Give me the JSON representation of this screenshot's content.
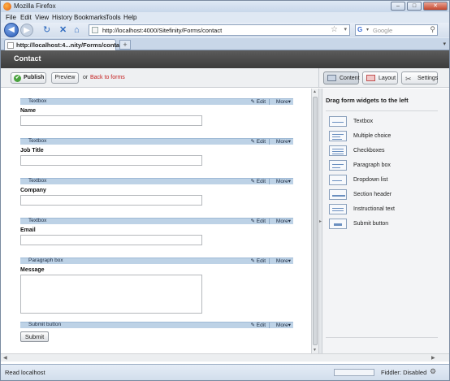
{
  "browser": {
    "window_title": "Mozilla Firefox",
    "menu": [
      "File",
      "Edit",
      "View",
      "History",
      "Bookmarks",
      "Tools",
      "Help"
    ],
    "url": "http://localhost:4000/Sitefinity/Forms/contact",
    "search_placeholder": "Google",
    "tab_title": "http://localhost:4...nity/Forms/contact",
    "new_tab_symbol": "+",
    "status_text": "Read localhost",
    "fiddler_status": "Fiddler: Disabled",
    "icons": [
      "back-icon",
      "forward-icon",
      "reload-icon",
      "stop-icon",
      "home-icon",
      "star-icon",
      "search-icon",
      "gear-icon"
    ]
  },
  "sitefinity": {
    "page_title": "Contact",
    "toolbar": {
      "publish_label": "Publish",
      "preview_label": "Preview",
      "or_text": "or",
      "back_label": "Back to forms",
      "content_label": "Content",
      "layout_label": "Layout",
      "settings_label": "Settings"
    },
    "fields": [
      {
        "widget": "Textbox",
        "label": "Name",
        "control": "input"
      },
      {
        "widget": "Textbox",
        "label": "Job Title",
        "control": "input"
      },
      {
        "widget": "Textbox",
        "label": "Company",
        "control": "input"
      },
      {
        "widget": "Textbox",
        "label": "Email",
        "control": "input"
      },
      {
        "widget": "Paragraph box",
        "label": "Message",
        "control": "textarea"
      },
      {
        "widget": "Submit button",
        "label": "Submit",
        "control": "button"
      }
    ],
    "widget_bar": {
      "edit_label": "Edit",
      "more_label": "More"
    },
    "sidebar": {
      "heading": "Drag form widgets to the left",
      "widgets": [
        "Textbox",
        "Multiple choice",
        "Checkboxes",
        "Paragraph box",
        "Dropdown list",
        "Section header",
        "Instructional text",
        "Submit button"
      ]
    }
  }
}
